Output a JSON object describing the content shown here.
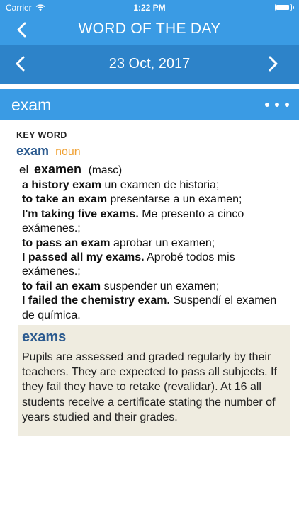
{
  "status_bar": {
    "carrier": "Carrier",
    "time": "1:22 PM"
  },
  "nav": {
    "title": "WORD OF THE DAY"
  },
  "date_bar": {
    "date": "23 Oct, 2017"
  },
  "word_bar": {
    "word": "exam"
  },
  "entry": {
    "key_word_label": "KEY WORD",
    "headword": "exam",
    "part_of_speech": "noun",
    "translation": {
      "article": "el",
      "word": "examen",
      "gender": "(masc)"
    },
    "examples": [
      {
        "en": "a history exam",
        "es": "un examen de historia;"
      },
      {
        "en": "to take an exam",
        "es": "presentarse a un examen;"
      },
      {
        "en": "I'm taking five exams.",
        "es": "Me presento a cinco exámenes.;"
      },
      {
        "en": "to pass an exam",
        "es": "aprobar un examen;"
      },
      {
        "en": "I passed all my exams.",
        "es": "Aprobé todos mis exámenes.;"
      },
      {
        "en": "to fail an exam",
        "es": "suspender un examen;"
      },
      {
        "en": "I failed the chemistry exam.",
        "es": "Suspendí el examen de química."
      }
    ]
  },
  "culture_note": {
    "title": "exams",
    "text": "Pupils are assessed and graded regularly by their teachers. They are expected to pass all subjects. If they fail they have to retake (revalidar). At 16 all students receive a certificate stating the number of years studied and their grades."
  },
  "colors": {
    "primary": "#3a9be4",
    "date_bar": "#2d83c9",
    "headword": "#2b5a8f",
    "part_of_speech": "#f0a235",
    "note_background": "#efece0"
  },
  "icons": {
    "back": "chevron-left-icon",
    "prev": "chevron-left-icon",
    "next": "chevron-right-icon",
    "more": "more-horizontal-icon",
    "wifi": "wifi-icon",
    "battery": "battery-icon"
  }
}
